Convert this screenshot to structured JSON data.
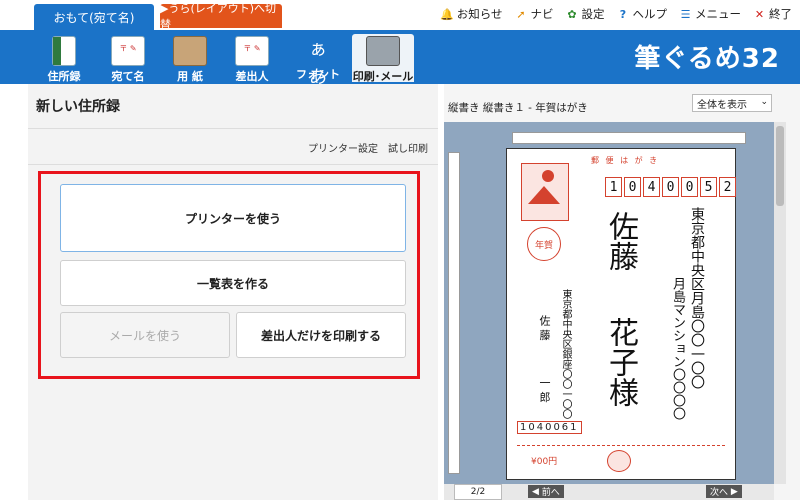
{
  "tabs": {
    "front": "おもて(宛て名)",
    "back": "▶うら(レイアウト)へ切替"
  },
  "topmenu": [
    {
      "label": "お知らせ",
      "icon": "bell-icon"
    },
    {
      "label": "ナビ",
      "icon": "navi-arrow-icon"
    },
    {
      "label": "設定",
      "icon": "gear-icon"
    },
    {
      "label": "ヘルプ",
      "icon": "help-icon"
    },
    {
      "label": "メニュー",
      "icon": "menu-icon"
    },
    {
      "label": "終了",
      "icon": "close-icon"
    }
  ],
  "toolbar": [
    {
      "label": "住所録",
      "icon": "address-book-icon"
    },
    {
      "label": "宛て名",
      "icon": "addressee-icon"
    },
    {
      "label": "用 紙",
      "icon": "paper-icon"
    },
    {
      "label": "差出人",
      "icon": "sender-icon"
    },
    {
      "label": "フォント",
      "icon": "font-icon",
      "glyph": "ぁあ"
    },
    {
      "label": "印刷･メール",
      "icon": "printer-icon",
      "active": true
    }
  ],
  "brand": "筆ぐるめ32",
  "left": {
    "title": "新しい住所録",
    "links": [
      "プリンター設定",
      "試し印刷"
    ],
    "buttons": {
      "printer": "プリンターを使う",
      "list": "一覧表を作る",
      "mail": "メールを使う",
      "sender_only": "差出人だけを印刷する"
    }
  },
  "right": {
    "title": "縦書き 縦書き１ - 年賀はがき",
    "zoom": "全体を表示",
    "card": {
      "header": "郵 便 は が き",
      "zip": [
        "1",
        "0",
        "4",
        "0",
        "0",
        "5",
        "2"
      ],
      "addr1": "東京都中央区月島〇〇一〇〇",
      "addr2": "月島マンション〇〇〇〇",
      "name_family": "佐藤",
      "name_given": "花子様",
      "sender_addr": "東京都中央区銀座〇〇一〇〇",
      "sender_family": "佐 藤",
      "sender_given": "一 郎",
      "sender_zip": "1040061",
      "stamp_label": "年賀",
      "price": "¥00円"
    },
    "page": "2/2",
    "prev": "前へ",
    "next": "次へ"
  }
}
